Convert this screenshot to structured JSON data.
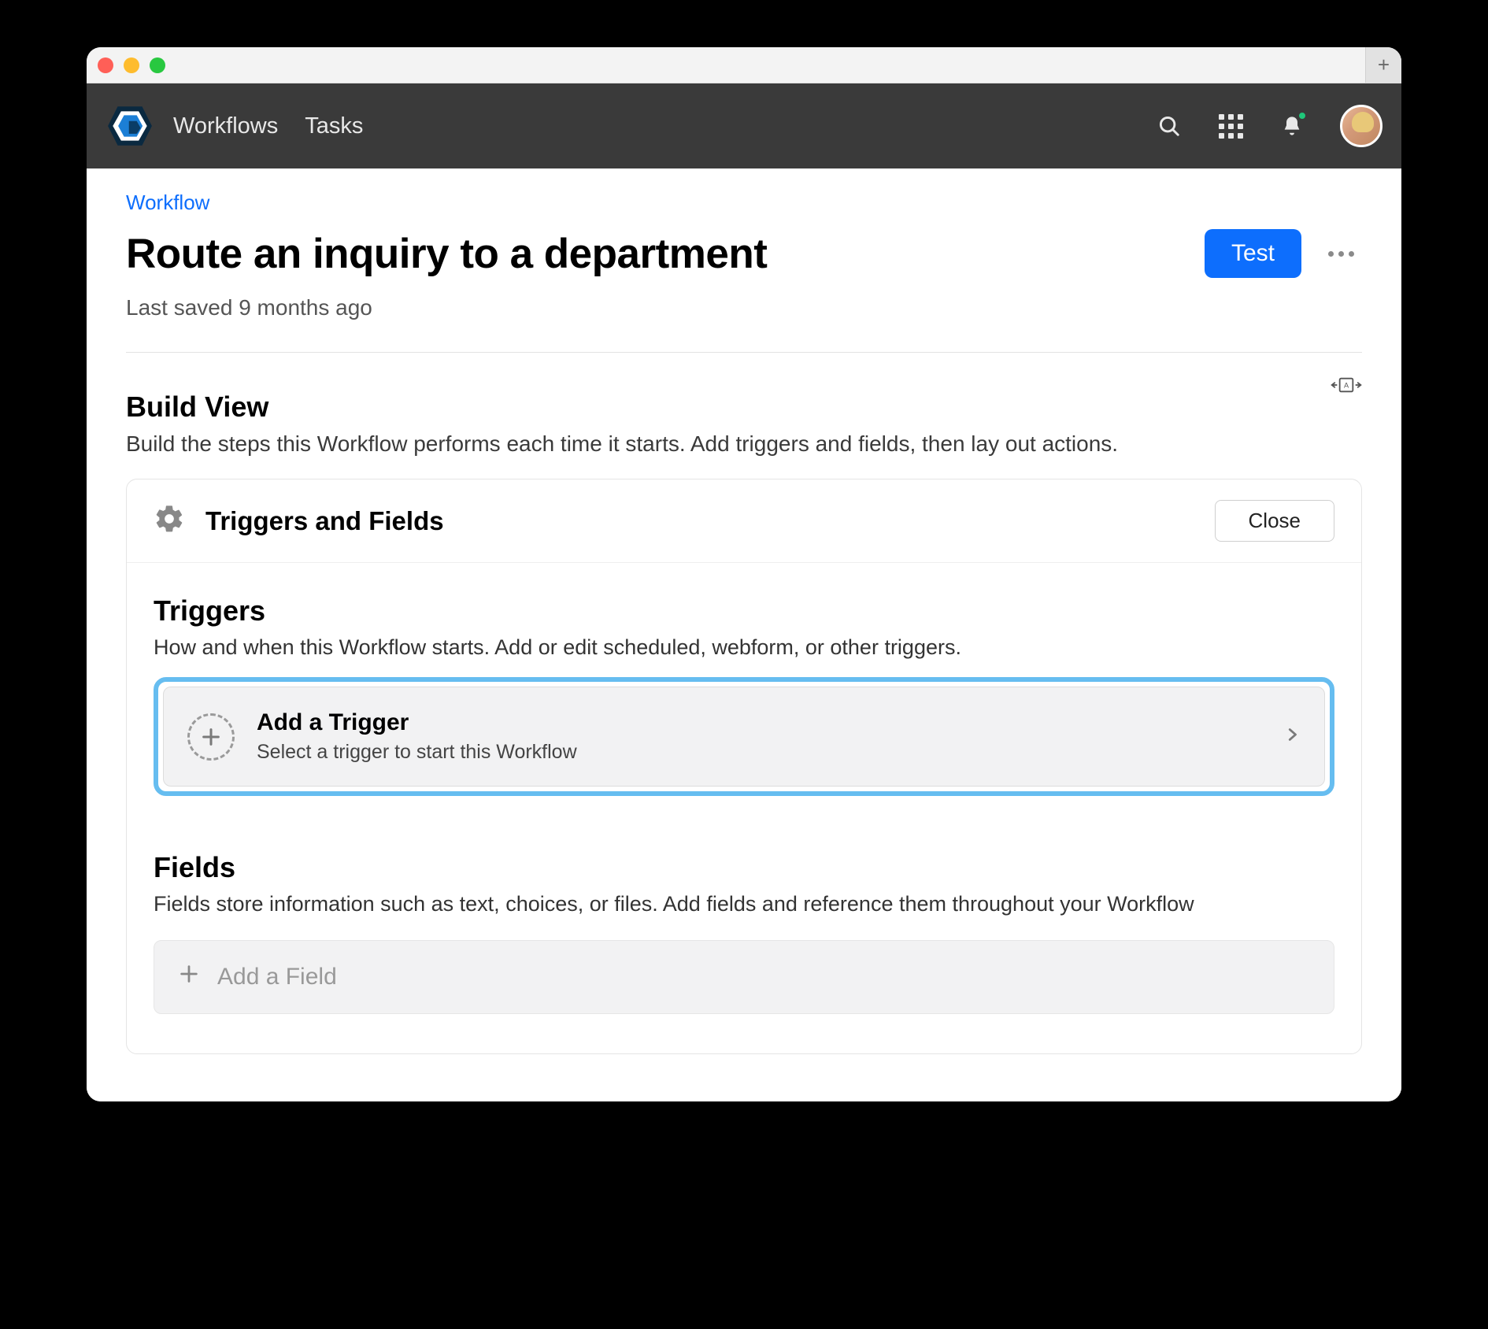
{
  "nav": {
    "workflows": "Workflows",
    "tasks": "Tasks"
  },
  "breadcrumb": "Workflow",
  "title": "Route an inquiry to a department",
  "test_label": "Test",
  "saved": "Last saved 9 months ago",
  "build_view": {
    "title": "Build View",
    "subtitle": "Build the steps this Workflow performs each time it starts. Add triggers and fields, then lay out actions."
  },
  "panel": {
    "title": "Triggers and Fields",
    "close_label": "Close",
    "triggers": {
      "heading": "Triggers",
      "subtitle": "How and when this Workflow starts. Add or edit scheduled, webform, or other triggers.",
      "add_title": "Add a Trigger",
      "add_subtitle": "Select a trigger to start this Workflow"
    },
    "fields": {
      "heading": "Fields",
      "subtitle": "Fields store information such as text, choices, or files. Add fields and reference them throughout your Workflow",
      "add_label": "Add a Field"
    }
  }
}
